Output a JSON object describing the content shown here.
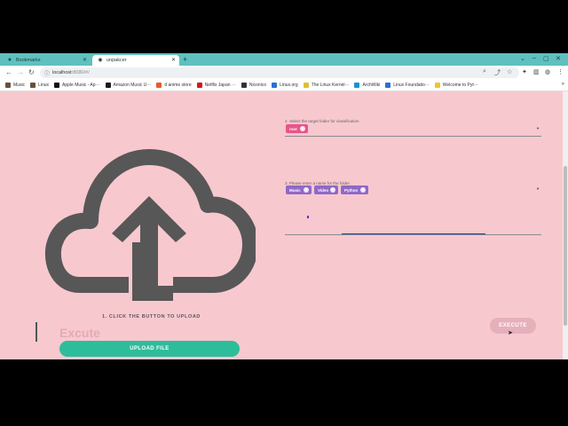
{
  "browser": {
    "tabs": [
      {
        "label": "Bookmarks",
        "icon": "star-icon",
        "active": false
      },
      {
        "label": "unpakcer",
        "icon": "globe-icon",
        "active": true
      }
    ],
    "new_tab": "+",
    "url_host": "localhost:",
    "url_path": "8080/#/",
    "bookmarks": [
      {
        "label": "Music",
        "color": "#6b4f3a"
      },
      {
        "label": "Linux",
        "color": "#6b4f3a"
      },
      {
        "label": "Apple Music - Ap···",
        "color": "#111111"
      },
      {
        "label": "Amazon Music U···",
        "color": "#1a1a1a"
      },
      {
        "label": "d anime store",
        "color": "#e85a2a"
      },
      {
        "label": "Netflix Japan ···",
        "color": "#d11a1a"
      },
      {
        "label": "Niconico",
        "color": "#333333"
      },
      {
        "label": "Linux.org",
        "color": "#2a6fd1"
      },
      {
        "label": "The Linux Kernel···",
        "color": "#e0c030"
      },
      {
        "label": "ArchWiki",
        "color": "#1793d1"
      },
      {
        "label": "Linux Foundatio···",
        "color": "#2a6fd1"
      },
      {
        "label": "Welcome to Pyt···",
        "color": "#f2c230"
      }
    ],
    "bookmarks_more": "»"
  },
  "left": {
    "upload_label": "1. CLICK THE BUTTON TO UPLOAD",
    "excute_text": "Excute",
    "upload_button": "UPLOAD FILE"
  },
  "right": {
    "section2_label": "2. Select the target folder for classification",
    "target_chips": [
      "root"
    ],
    "section3_label": "3. Please enter a name for the folder",
    "name_chips": [
      "Music",
      "Video",
      "Python"
    ],
    "execute_button": "EXECUTE"
  },
  "colors": {
    "page_bg": "#f8c8cf",
    "chip_pink": "#e8558a",
    "chip_purple": "#9068c8",
    "upload_btn": "#2ebd9b",
    "tab_strip": "#5ec1c0"
  }
}
